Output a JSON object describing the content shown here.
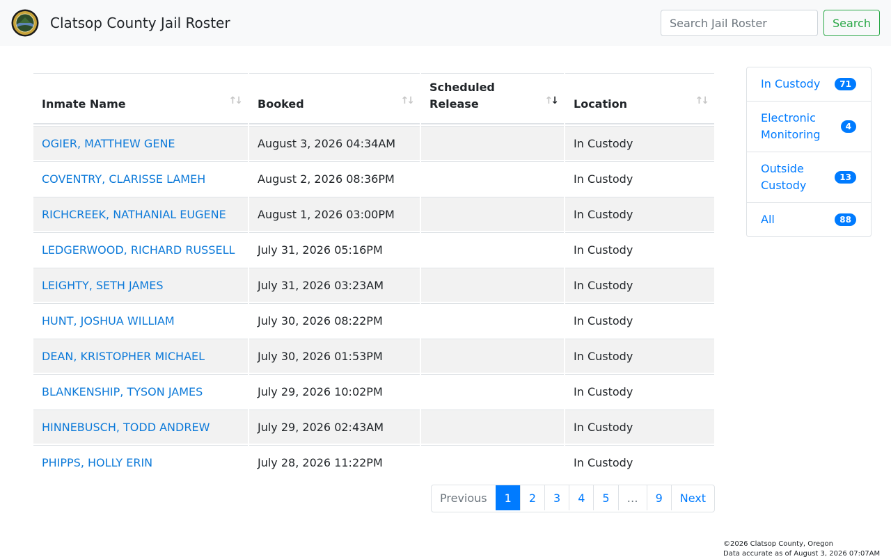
{
  "header": {
    "title": "Clatsop County Jail Roster",
    "search_placeholder": "Search Jail Roster",
    "search_label": "Search"
  },
  "table": {
    "columns": [
      "Inmate Name",
      "Booked",
      "Scheduled Release",
      "Location"
    ],
    "rows": [
      {
        "name": "OGIER, MATTHEW GENE",
        "booked": "August 3, 2026 04:34AM",
        "release": "",
        "location": "In Custody"
      },
      {
        "name": "COVENTRY, CLARISSE LAMEH",
        "booked": "August 2, 2026 08:36PM",
        "release": "",
        "location": "In Custody"
      },
      {
        "name": "RICHCREEK, NATHANIAL EUGENE",
        "booked": "August 1, 2026 03:00PM",
        "release": "",
        "location": "In Custody"
      },
      {
        "name": "LEDGERWOOD, RICHARD RUSSELL",
        "booked": "July 31, 2026 05:16PM",
        "release": "",
        "location": "In Custody"
      },
      {
        "name": "LEIGHTY, SETH JAMES",
        "booked": "July 31, 2026 03:23AM",
        "release": "",
        "location": "In Custody"
      },
      {
        "name": "HUNT, JOSHUA WILLIAM",
        "booked": "July 30, 2026 08:22PM",
        "release": "",
        "location": "In Custody"
      },
      {
        "name": "DEAN, KRISTOPHER MICHAEL",
        "booked": "July 30, 2026 01:53PM",
        "release": "",
        "location": "In Custody"
      },
      {
        "name": "BLANKENSHIP, TYSON JAMES",
        "booked": "July 29, 2026 10:02PM",
        "release": "",
        "location": "In Custody"
      },
      {
        "name": "HINNEBUSCH, TODD ANDREW",
        "booked": "July 29, 2026 02:43AM",
        "release": "",
        "location": "In Custody"
      },
      {
        "name": "PHIPPS, HOLLY ERIN",
        "booked": "July 28, 2026 11:22PM",
        "release": "",
        "location": "In Custody"
      }
    ]
  },
  "pagination": {
    "previous": "Previous",
    "pages": [
      "1",
      "2",
      "3",
      "4",
      "5"
    ],
    "ellipsis": "…",
    "last": "9",
    "next": "Next",
    "current": "1"
  },
  "sidebar": {
    "items": [
      {
        "label": "In Custody",
        "count": "71"
      },
      {
        "label": "Electronic Monitoring",
        "count": "4"
      },
      {
        "label": "Outside Custody",
        "count": "13"
      },
      {
        "label": "All",
        "count": "88"
      }
    ]
  },
  "footer": {
    "copyright": "©2026 Clatsop County, Oregon",
    "accuracy": "Data accurate as of August 3, 2026 07:07AM"
  },
  "colors": {
    "link": "#0d7ad9",
    "primary": "#007bff",
    "success": "#28a745",
    "stripe": "#f2f2f2"
  },
  "icons": {
    "logo": "county-seal-icon",
    "sort": "sort-arrows-icon"
  }
}
